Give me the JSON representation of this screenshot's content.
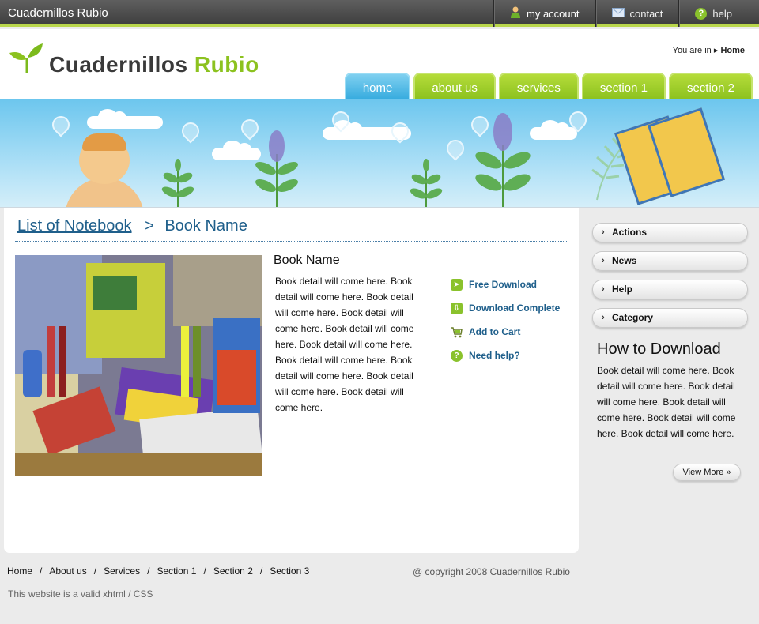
{
  "topbar": {
    "site_name": "Cuadernillos Rubio",
    "links": [
      {
        "label": "my account",
        "icon": "user-icon"
      },
      {
        "label": "contact",
        "icon": "envelope-icon"
      },
      {
        "label": "help",
        "icon": "help-icon"
      }
    ]
  },
  "header": {
    "logo_part1": "Cuadernillos",
    "logo_part2": "Rubio",
    "you_are_in": "You are in",
    "current": "Home"
  },
  "nav": {
    "tabs": [
      "home",
      "about us",
      "services",
      "section 1",
      "section 2"
    ],
    "active": "home"
  },
  "main": {
    "crumb_link": "List of Notebook",
    "crumb_sep": ">",
    "crumb_current": "Book Name",
    "book_title": "Book Name",
    "book_desc": "Book detail will come here. Book detail will come here. Book detail will come here. Book detail will come here. Book detail will come here. Book detail will come here. Book detail will come here. Book detail will come here. Book detail will come here. Book detail will come here.",
    "actions": [
      {
        "label": "Free Download",
        "icon": "download-arrow-icon"
      },
      {
        "label": "Download Complete",
        "icon": "download-complete-icon"
      },
      {
        "label": "Add to Cart",
        "icon": "cart-icon"
      },
      {
        "label": "Need help?",
        "icon": "help-icon"
      }
    ]
  },
  "sidebar": {
    "menu": [
      "Actions",
      "News",
      "Help",
      "Category"
    ],
    "heading": "How to Download",
    "text": "Book detail will come here. Book detail will come here. Book detail will come here. Book detail will come here. Book detail will come here. Book detail will come here.",
    "view_more": "View More"
  },
  "footer": {
    "links": [
      "Home",
      "About us",
      "Services",
      "Section 1",
      "Section 2",
      "Section 3"
    ],
    "sep": "/",
    "copyright": "@ copyright 2008 Cuadernillos Rubio",
    "valid_text": "This website is a valid",
    "xhtml": "xhtml",
    "css": "CSS"
  },
  "colors": {
    "accent_green": "#8cc21f",
    "accent_blue": "#38acdf",
    "link_blue": "#1f5f8b"
  }
}
